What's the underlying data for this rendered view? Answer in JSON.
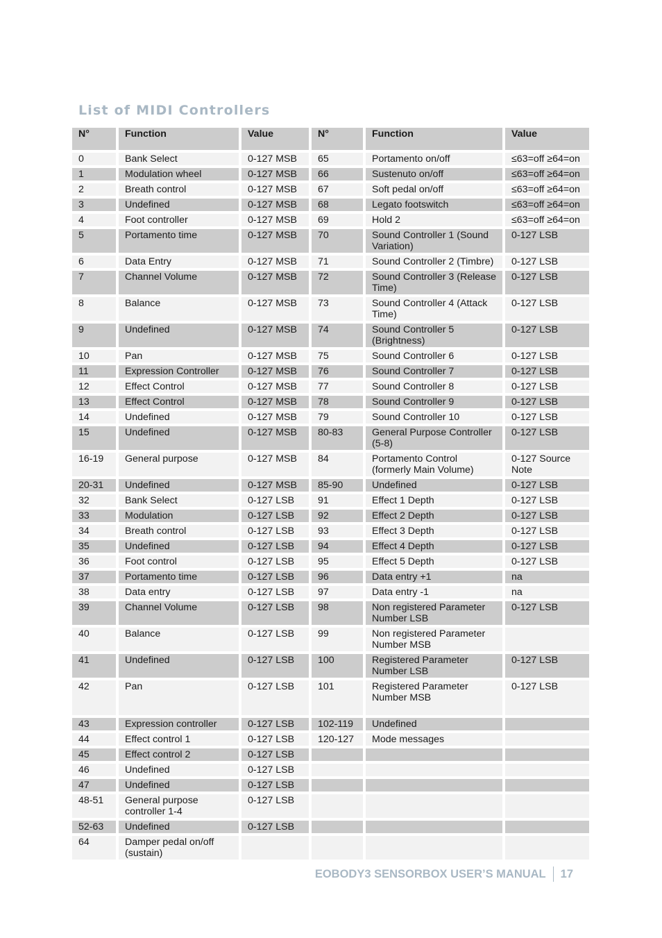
{
  "document": {
    "title": "List of MIDI Controllers",
    "footer": {
      "manual_title": "EOBODY3 SENSORBOX USER’S MANUAL",
      "page_number": "17"
    }
  },
  "table": {
    "headers": [
      "N°",
      "Function",
      "Value",
      "N°",
      "Function",
      "Value"
    ],
    "rows": [
      {
        "shade": "light",
        "h": "s",
        "c": [
          "0",
          "Bank Select",
          "0-127 MSB",
          "65",
          "Portamento on/off",
          "≤63=off ≥64=on"
        ]
      },
      {
        "shade": "dark",
        "h": "s",
        "c": [
          "1",
          "Modulation wheel",
          "0-127  MSB",
          "66",
          "Sustenuto on/off",
          "≤63=off ≥64=on"
        ]
      },
      {
        "shade": "light",
        "h": "s",
        "c": [
          "2",
          "Breath control",
          "0-127  MSB",
          "67",
          "Soft pedal on/off",
          "≤63=off ≥64=on"
        ]
      },
      {
        "shade": "dark",
        "h": "s",
        "c": [
          "3",
          "Undefined",
          "0-127  MSB",
          "68",
          "Legato footswitch",
          "≤63=off ≥64=on"
        ]
      },
      {
        "shade": "light",
        "h": "s",
        "c": [
          "4",
          "Foot controller",
          "0-127  MSB",
          "69",
          "Hold 2",
          "≤63=off ≥64=on"
        ]
      },
      {
        "shade": "dark",
        "h": "d",
        "c": [
          "5",
          "Portamento time",
          "0-127  MSB",
          "70",
          "Sound Controller 1 (Sound Variation)",
          "0-127  LSB"
        ]
      },
      {
        "shade": "light",
        "h": "s",
        "c": [
          "6",
          "Data Entry",
          "0-127  MSB",
          "71",
          "Sound Controller 2 (Timbre)",
          "0-127  LSB"
        ]
      },
      {
        "shade": "dark",
        "h": "d",
        "c": [
          "7",
          "Channel Volume",
          "0-127  MSB",
          "72",
          "Sound Controller 3 (Release Time)",
          "0-127  LSB"
        ]
      },
      {
        "shade": "light",
        "h": "d",
        "c": [
          "8",
          "Balance",
          "0-127  MSB",
          "73",
          "Sound Controller 4 (Attack Time)",
          "0-127  LSB"
        ]
      },
      {
        "shade": "dark",
        "h": "d",
        "c": [
          "9",
          "Undefined",
          "0-127  MSB",
          "74",
          "Sound Controller 5 (Brightness)",
          "0-127  LSB"
        ]
      },
      {
        "shade": "light",
        "h": "s",
        "c": [
          "10",
          "Pan",
          "0-127  MSB",
          "75",
          "Sound Controller 6",
          "0-127  LSB"
        ]
      },
      {
        "shade": "dark",
        "h": "s",
        "c": [
          "11",
          "Expression Controller",
          "0-127  MSB",
          "76",
          "Sound Controller 7",
          "0-127  LSB"
        ]
      },
      {
        "shade": "light",
        "h": "s",
        "c": [
          "12",
          "Effect Control",
          "0-127  MSB",
          "77",
          "Sound Controller 8",
          "0-127  LSB"
        ]
      },
      {
        "shade": "dark",
        "h": "s",
        "c": [
          "13",
          "Effect Control",
          "0-127  MSB",
          "78",
          "Sound Controller 9",
          "0-127  LSB"
        ]
      },
      {
        "shade": "light",
        "h": "s",
        "c": [
          "14",
          "Undefined",
          "0-127  MSB",
          "79",
          "Sound Controller 10",
          "0-127  LSB"
        ]
      },
      {
        "shade": "dark",
        "h": "d",
        "c": [
          "15",
          "Undefined",
          "0-127  MSB",
          "80-83",
          "General Purpose Controller (5-8)",
          "0-127  LSB"
        ]
      },
      {
        "shade": "light",
        "h": "d",
        "c": [
          "16-19",
          "General purpose",
          "0-127  MSB",
          "84",
          "Portamento Control (formerly Main Volume)",
          "0-127  Source Note"
        ]
      },
      {
        "shade": "dark",
        "h": "s",
        "c": [
          "20-31",
          "Undefined",
          "0-127  MSB",
          "85-90",
          "Undefined",
          "0-127  LSB"
        ]
      },
      {
        "shade": "light",
        "h": "s",
        "c": [
          "32",
          "Bank Select",
          "0-127 LSB",
          "91",
          "Effect 1 Depth",
          "0-127  LSB"
        ]
      },
      {
        "shade": "dark",
        "h": "s",
        "c": [
          "33",
          "Modulation",
          "0-127 LSB",
          "92",
          "Effect 2 Depth",
          "0-127  LSB"
        ]
      },
      {
        "shade": "light",
        "h": "s",
        "c": [
          "34",
          "Breath control",
          "0-127 LSB",
          "93",
          "Effect 3 Depth",
          "0-127  LSB"
        ]
      },
      {
        "shade": "dark",
        "h": "s",
        "c": [
          "35",
          "Undefined",
          "0-127 LSB",
          "94",
          "Effect 4 Depth",
          "0-127  LSB"
        ]
      },
      {
        "shade": "light",
        "h": "s",
        "c": [
          "36",
          "Foot control",
          "0-127 LSB",
          "95",
          "Effect 5 Depth",
          "0-127  LSB"
        ]
      },
      {
        "shade": "dark",
        "h": "s",
        "c": [
          "37",
          "Portamento time",
          "0-127 LSB",
          "96",
          "Data entry +1",
          "na"
        ]
      },
      {
        "shade": "light",
        "h": "s",
        "c": [
          "38",
          "Data entry",
          "0-127 LSB",
          "97",
          "Data entry -1",
          "na"
        ]
      },
      {
        "shade": "dark",
        "h": "d",
        "c": [
          "39",
          "Channel Volume",
          "0-127 LSB",
          "98",
          "Non registered Parameter Number LSB",
          "0-127  LSB"
        ]
      },
      {
        "shade": "light",
        "h": "d",
        "c": [
          "40",
          "Balance",
          "0-127 LSB",
          "99",
          "Non registered Parameter Number MSB",
          ""
        ]
      },
      {
        "shade": "dark",
        "h": "d",
        "c": [
          "41",
          "Undefined",
          "0-127 LSB",
          "100",
          "Registered Parameter Number LSB",
          "0-127  LSB"
        ]
      },
      {
        "shade": "light",
        "h": "t",
        "c": [
          "42",
          "Pan",
          "0-127 LSB",
          "101",
          "Registered Parameter Number MSB",
          "0-127  LSB"
        ]
      },
      {
        "shade": "dark",
        "h": "s",
        "c": [
          "43",
          "Expression controller",
          "0-127 LSB",
          "102-119",
          "Undefined",
          ""
        ]
      },
      {
        "shade": "light",
        "h": "s",
        "c": [
          "44",
          "Effect control 1",
          "0-127 LSB",
          "120-127",
          "Mode messages",
          ""
        ]
      },
      {
        "shade": "dark",
        "h": "s",
        "c": [
          "45",
          "Effect control 2",
          "0-127 LSB",
          "",
          "",
          ""
        ]
      },
      {
        "shade": "light",
        "h": "s",
        "c": [
          "46",
          "Undefined",
          "0-127 LSB",
          "",
          "",
          ""
        ]
      },
      {
        "shade": "dark",
        "h": "s",
        "c": [
          "47",
          "Undefined",
          "0-127 LSB",
          "",
          "",
          ""
        ]
      },
      {
        "shade": "light",
        "h": "d",
        "c": [
          "48-51",
          "General purpose controller 1-4",
          "0-127 LSB",
          "",
          "",
          ""
        ]
      },
      {
        "shade": "dark",
        "h": "s",
        "c": [
          "52-63",
          "Undefined",
          "0-127 LSB",
          "",
          "",
          ""
        ]
      },
      {
        "shade": "light",
        "h": "d",
        "c": [
          "64",
          "Damper pedal on/off (sustain)",
          "",
          "",
          "",
          ""
        ]
      }
    ]
  }
}
